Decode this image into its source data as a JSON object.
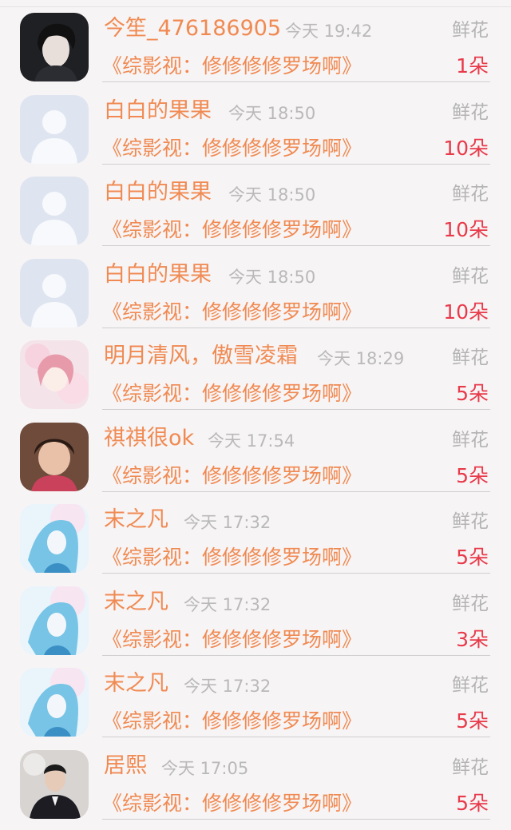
{
  "records": [
    {
      "name": "今笙_476186905",
      "time": "今天 19:42",
      "gift": "鲜花",
      "book": "《综影视：修修修修罗场啊》",
      "amount": "1朵",
      "avatar_icon": "avatar-photo-man-dark-hair"
    },
    {
      "name": "白白的果果",
      "time": "今天 18:50",
      "gift": "鲜花",
      "book": "《综影视：修修修修罗场啊》",
      "amount": "10朵",
      "avatar_icon": "default-avatar-icon"
    },
    {
      "name": "白白的果果",
      "time": "今天 18:50",
      "gift": "鲜花",
      "book": "《综影视：修修修修罗场啊》",
      "amount": "10朵",
      "avatar_icon": "default-avatar-icon"
    },
    {
      "name": "白白的果果",
      "time": "今天 18:50",
      "gift": "鲜花",
      "book": "《综影视：修修修修罗场啊》",
      "amount": "10朵",
      "avatar_icon": "default-avatar-icon"
    },
    {
      "name": "明月清风，傲雪凌霜",
      "time": "今天 18:29",
      "gift": "鲜花",
      "book": "《综影视：修修修修罗场啊》",
      "amount": "5朵",
      "avatar_icon": "avatar-anime-pink"
    },
    {
      "name": "祺祺很ok",
      "time": "今天 17:54",
      "gift": "鲜花",
      "book": "《综影视：修修修修罗场啊》",
      "amount": "5朵",
      "avatar_icon": "avatar-photo-child"
    },
    {
      "name": "末之凡",
      "time": "今天 17:32",
      "gift": "鲜花",
      "book": "《综影视：修修修修罗场啊》",
      "amount": "5朵",
      "avatar_icon": "avatar-anime-blue"
    },
    {
      "name": "末之凡",
      "time": "今天 17:32",
      "gift": "鲜花",
      "book": "《综影视：修修修修罗场啊》",
      "amount": "3朵",
      "avatar_icon": "avatar-anime-blue"
    },
    {
      "name": "末之凡",
      "time": "今天 17:32",
      "gift": "鲜花",
      "book": "《综影视：修修修修罗场啊》",
      "amount": "5朵",
      "avatar_icon": "avatar-anime-blue"
    },
    {
      "name": "居熙",
      "time": "今天 17:05",
      "gift": "鲜花",
      "book": "《综影视：修修修修罗场啊》",
      "amount": "5朵",
      "avatar_icon": "avatar-photo-man-suit"
    }
  ],
  "colors": {
    "name": "#f08a52",
    "book": "#f08a52",
    "amount": "#e83a4a",
    "meta": "#b9b9b9",
    "background": "#f7f4f5"
  }
}
